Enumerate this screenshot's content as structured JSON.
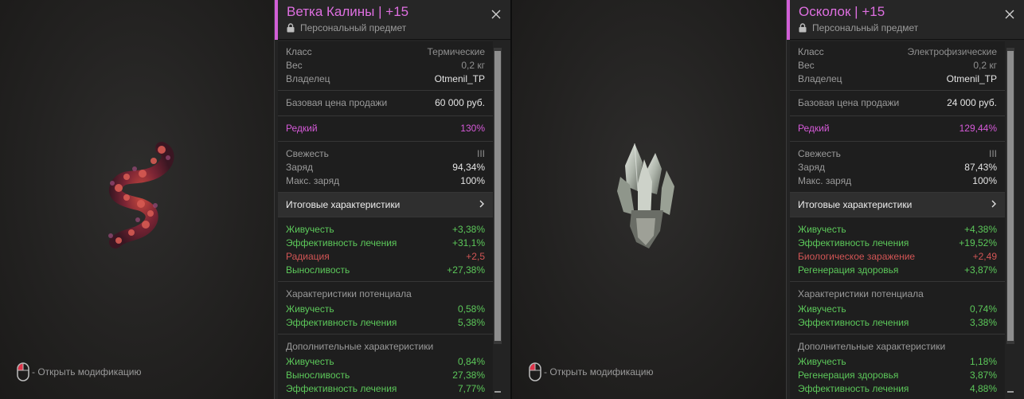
{
  "left": {
    "title": "Ветка Калины",
    "level": "+15",
    "subtitle": "Персональный предмет",
    "hint": "- Открыть модификацию",
    "info": [
      {
        "label": "Класс",
        "value": "Термические"
      },
      {
        "label": "Вес",
        "value": "0,2 кг"
      },
      {
        "label": "Владелец",
        "value": "Otmenil_TP"
      }
    ],
    "price": {
      "label": "Базовая цена продажи",
      "value": "60 000 руб."
    },
    "rarity": {
      "label": "Редкий",
      "value": "130%"
    },
    "state": [
      {
        "label": "Свежесть",
        "value": "III"
      },
      {
        "label": "Заряд",
        "value": "94,34%"
      },
      {
        "label": "Макс. заряд",
        "value": "100%"
      }
    ],
    "summary_label": "Итоговые характеристики",
    "stats": [
      {
        "label": "Живучесть",
        "value": "+3,38%"
      },
      {
        "label": "Эффективность лечения",
        "value": "+31,1%"
      },
      {
        "label": "Радиация",
        "value": "+2,5"
      },
      {
        "label": "Выносливость",
        "value": "+27,38%"
      }
    ],
    "potential_title": "Характеристики потенциала",
    "potential": [
      {
        "label": "Живучесть",
        "value": "0,58%"
      },
      {
        "label": "Эффективность лечения",
        "value": "5,38%"
      }
    ],
    "additional_title": "Дополнительные характеристики",
    "additional": [
      {
        "label": "Живучесть",
        "value": "0,84%"
      },
      {
        "label": "Выносливость",
        "value": "27,38%"
      },
      {
        "label": "Эффективность лечения",
        "value": "7,77%"
      }
    ]
  },
  "right": {
    "title": "Осколок",
    "level": "+15",
    "subtitle": "Персональный предмет",
    "hint": "- Открыть модификацию",
    "info": [
      {
        "label": "Класс",
        "value": "Электрофизические"
      },
      {
        "label": "Вес",
        "value": "0,2 кг"
      },
      {
        "label": "Владелец",
        "value": "Otmenil_TP"
      }
    ],
    "price": {
      "label": "Базовая цена продажи",
      "value": "24 000 руб."
    },
    "rarity": {
      "label": "Редкий",
      "value": "129,44%"
    },
    "state": [
      {
        "label": "Свежесть",
        "value": "III"
      },
      {
        "label": "Заряд",
        "value": "87,43%"
      },
      {
        "label": "Макс. заряд",
        "value": "100%"
      }
    ],
    "summary_label": "Итоговые характеристики",
    "stats": [
      {
        "label": "Живучесть",
        "value": "+4,38%"
      },
      {
        "label": "Эффективность лечения",
        "value": "+19,52%"
      },
      {
        "label": "Биологическое заражение",
        "value": "+2,49"
      },
      {
        "label": "Регенерация здоровья",
        "value": "+3,87%"
      }
    ],
    "potential_title": "Характеристики потенциала",
    "potential": [
      {
        "label": "Живучесть",
        "value": "0,74%"
      },
      {
        "label": "Эффективность лечения",
        "value": "3,38%"
      }
    ],
    "additional_title": "Дополнительные характеристики",
    "additional": [
      {
        "label": "Живучесть",
        "value": "1,18%"
      },
      {
        "label": "Регенерация здоровья",
        "value": "3,87%"
      },
      {
        "label": "Эффективность лечения",
        "value": "4,88%"
      }
    ]
  },
  "icons": {
    "lock": "lock-icon",
    "close": "close-icon",
    "mouse": "mouse-left-click-icon",
    "chevron": "chevron-right-icon"
  },
  "colors": {
    "accent": "#d25fd7",
    "rare": "#d65ad9",
    "positive": "#5cc85a",
    "negative": "#d25555"
  }
}
